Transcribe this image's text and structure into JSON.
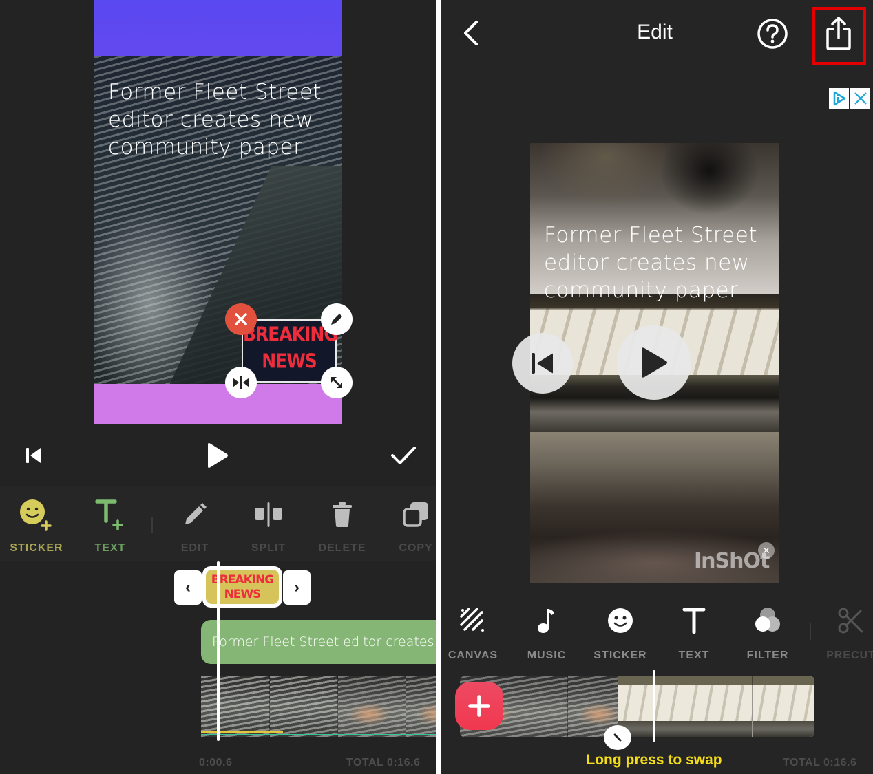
{
  "left": {
    "preview": {
      "overlay_text": "Former Fleet Street editor creates new community paper",
      "sticker_text": "BREAKING NEWS",
      "sticker_handles": [
        "delete-sticker",
        "edit-sticker",
        "flip-sticker",
        "resize-sticker"
      ]
    },
    "controls": {
      "rewind_icon": "skip-back-icon",
      "play_icon": "play-icon",
      "confirm_icon": "checkmark-icon"
    },
    "tools": [
      {
        "id": "sticker",
        "label": "STICKER",
        "icon": "sticker-add-icon",
        "color": "#a9a554",
        "active": true
      },
      {
        "id": "text",
        "label": "TEXT",
        "icon": "text-add-icon",
        "color": "#6d9f62",
        "active": true
      },
      {
        "id": "edit",
        "label": "EDIT",
        "icon": "pencil-icon",
        "color": "#4a4a4a",
        "active": false
      },
      {
        "id": "split",
        "label": "SPLIT",
        "icon": "split-icon",
        "color": "#4a4a4a",
        "active": false
      },
      {
        "id": "delete",
        "label": "DELETE",
        "icon": "trash-icon",
        "color": "#4a4a4a",
        "active": false
      },
      {
        "id": "copy",
        "label": "COPY",
        "icon": "copy-icon",
        "color": "#4a4a4a",
        "active": false
      }
    ],
    "timeline": {
      "sticker_clip_text": "BREAKING NEWS",
      "prev_arrow": "‹",
      "next_arrow": "›",
      "text_clip": "Former Fleet Street editor creates new community paper",
      "current_time": "0:00.6",
      "total_time": "TOTAL 0:16.6"
    }
  },
  "right": {
    "header": {
      "title": "Edit",
      "back_icon": "chevron-left-icon",
      "help_icon": "help-circle-icon",
      "share_icon": "share-icon",
      "share_highlighted": true
    },
    "ad": {
      "adchoices_icon": "adchoices-icon",
      "close_icon": "close-icon"
    },
    "preview": {
      "overlay_text": "Former Fleet Street editor creates new community paper",
      "watermark": "InShOt",
      "watermark_close": "×"
    },
    "tools": [
      {
        "id": "canvas",
        "label": "CANVAS",
        "icon": "canvas-icon",
        "enabled": true
      },
      {
        "id": "music",
        "label": "MUSIC",
        "icon": "music-note-icon",
        "enabled": true
      },
      {
        "id": "sticker",
        "label": "STICKER",
        "icon": "smiley-icon",
        "enabled": true
      },
      {
        "id": "text",
        "label": "TEXT",
        "icon": "text-icon",
        "enabled": true
      },
      {
        "id": "filter",
        "label": "FILTER",
        "icon": "filter-icon",
        "enabled": true
      },
      {
        "id": "precut",
        "label": "PRECUT",
        "icon": "scissors-icon",
        "enabled": false
      }
    ],
    "timeline": {
      "add_clip_icon": "plus-icon",
      "transition_icon": "transition-icon",
      "hint": "Long press to swap",
      "total_time": "TOTAL 0:16.6"
    }
  },
  "colors": {
    "background": "#232323",
    "accent_red": "#f0384f",
    "highlight": "#e40000",
    "hint_yellow": "#f3dc1a",
    "text_clip_green": "#86b676",
    "sticker_clip_yellow": "#d6c35a"
  }
}
